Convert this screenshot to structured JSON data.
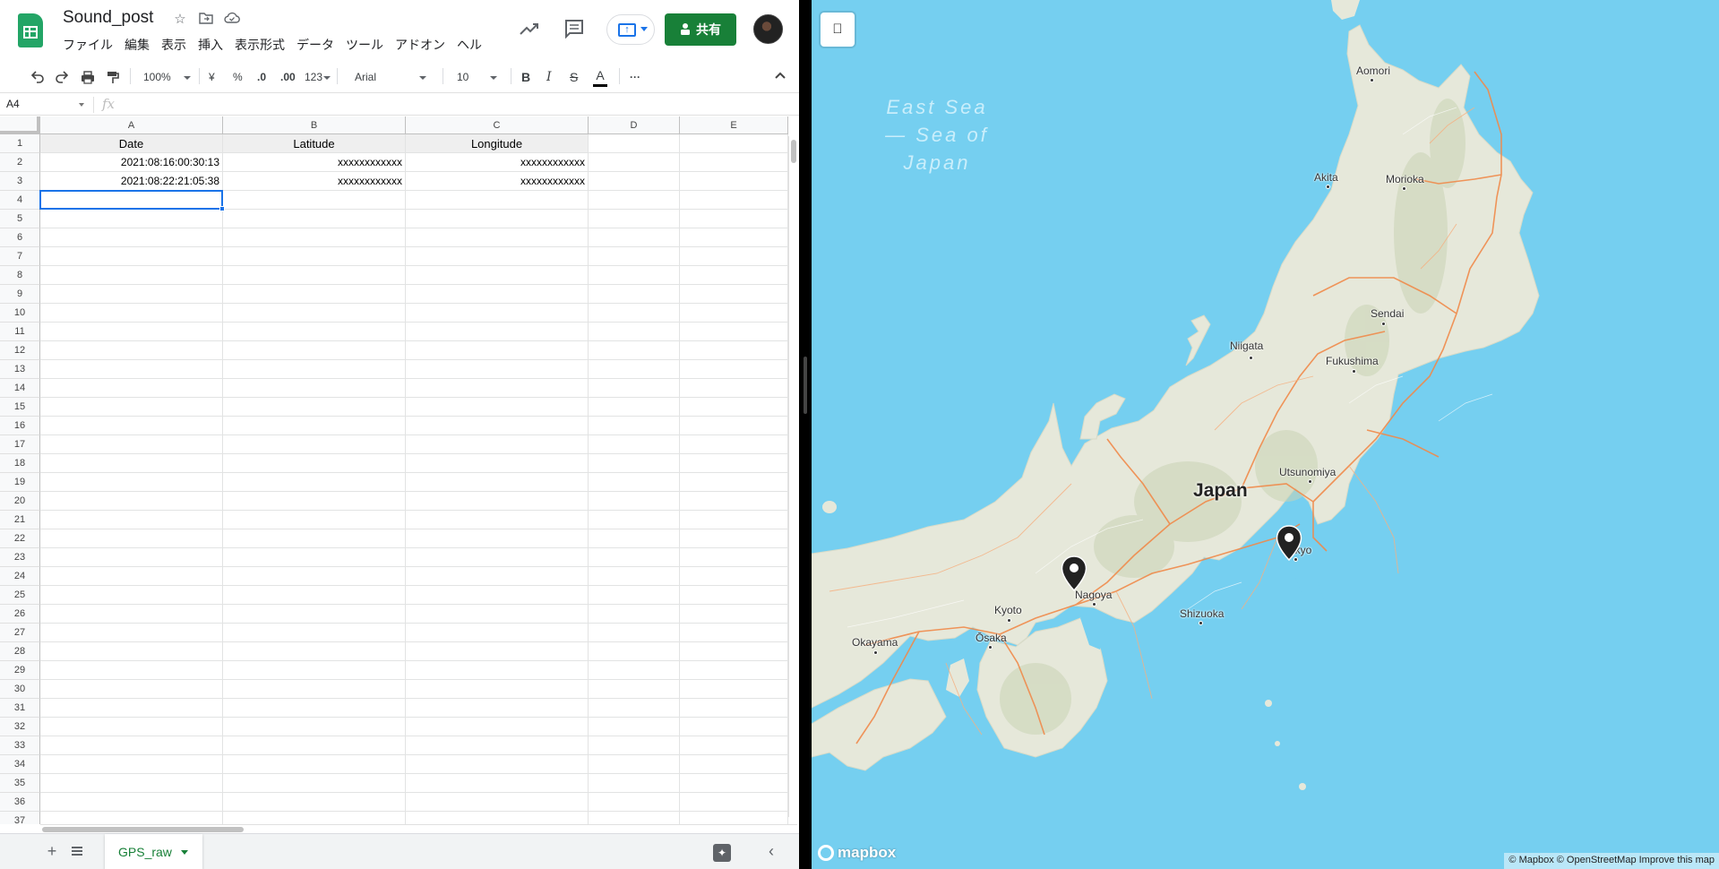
{
  "sheet": {
    "title": "Sound_post",
    "menu": [
      "ファイル",
      "編集",
      "表示",
      "挿入",
      "表示形式",
      "データ",
      "ツール",
      "アドオン",
      "ヘル"
    ],
    "share_label": "共有",
    "toolbar": {
      "zoom": "100%",
      "currency": "¥",
      "percent": "%",
      "dec_less": ".0",
      "dec_more": ".00",
      "number_format": "123",
      "font": "Arial",
      "font_size": "10",
      "more": "···"
    },
    "name_box": "A4",
    "fx": "fx",
    "columns": [
      "A",
      "B",
      "C",
      "D",
      "E"
    ],
    "rows": [
      "1",
      "2",
      "3",
      "4",
      "5",
      "6",
      "7",
      "8",
      "9",
      "10",
      "11",
      "12",
      "13",
      "14",
      "15",
      "16",
      "17",
      "18",
      "19",
      "20",
      "21",
      "22",
      "23",
      "24",
      "25",
      "26",
      "27",
      "28",
      "29",
      "30",
      "31",
      "32",
      "33",
      "34",
      "35",
      "36",
      "37"
    ],
    "header_row": [
      "Date",
      "Latitude",
      "Longitude"
    ],
    "data_rows": [
      [
        "2021:08:16:00:30:13",
        "xxxxxxxxxxxx",
        "xxxxxxxxxxxx"
      ],
      [
        "2021:08:22:21:05:38",
        "xxxxxxxxxxxx",
        "xxxxxxxxxxxx"
      ]
    ],
    "selected_cell": "A4",
    "sheet_tab": "GPS_raw",
    "colors": {
      "brand_green": "#188038",
      "selection_blue": "#1a73e8",
      "header_gray": "#efefef"
    }
  },
  "map": {
    "sea_label": "East Sea — Sea of Japan",
    "country": "Japan",
    "cities": [
      "Aomori",
      "Akita",
      "Morioka",
      "Sendai",
      "Niigata",
      "Fukushima",
      "Utsunomiya",
      "Nagoya",
      "Kyoto",
      "Shizuoka",
      "Ōsaka",
      "Okayama",
      "Tokyo"
    ],
    "pins": [
      "Nagoya",
      "Tokyo"
    ],
    "logo": "mapbox",
    "attribution": "© Mapbox © OpenStreetMap Improve this map",
    "colors": {
      "water": "#75cff0",
      "land": "#e6e8da",
      "roads": "#f08a4b"
    }
  }
}
